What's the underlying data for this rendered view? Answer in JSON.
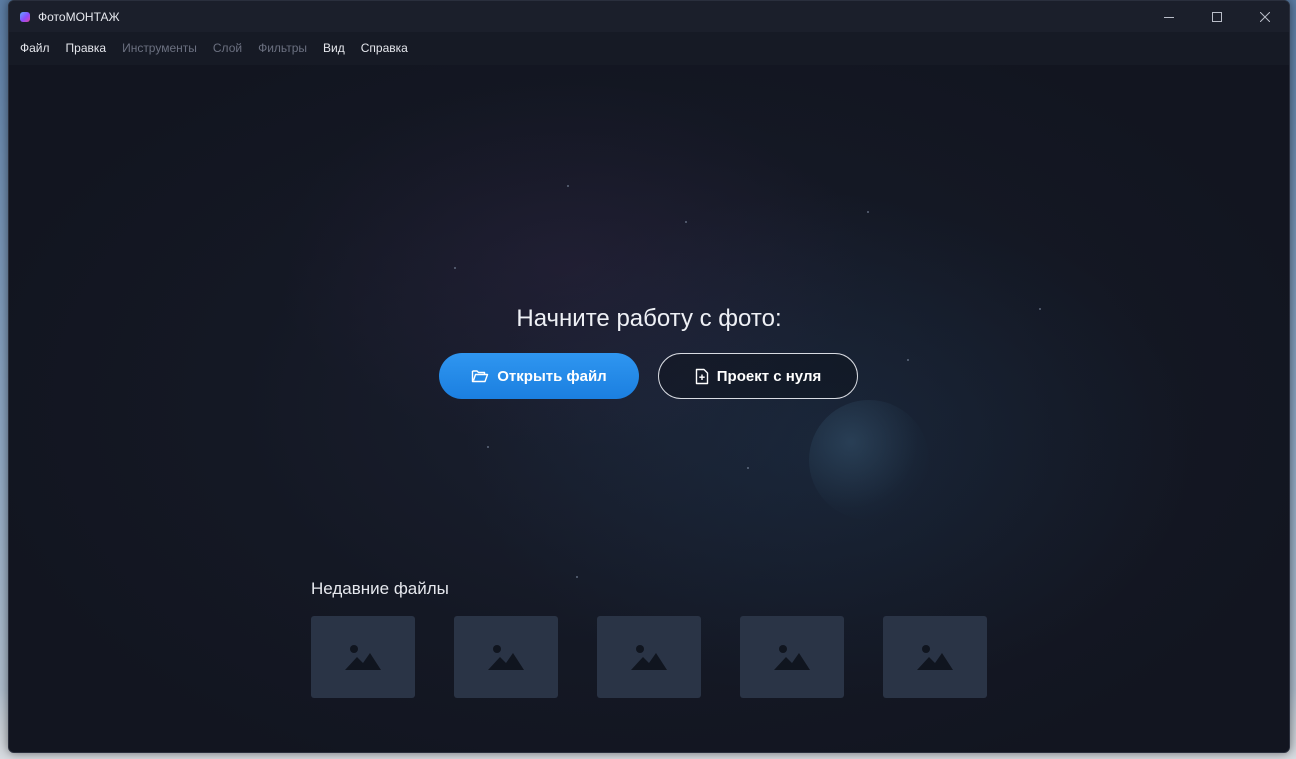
{
  "window": {
    "title": "ФотоМОНТАЖ"
  },
  "menu": [
    {
      "label": "Файл",
      "enabled": true
    },
    {
      "label": "Правка",
      "enabled": true
    },
    {
      "label": "Инструменты",
      "enabled": false
    },
    {
      "label": "Слой",
      "enabled": false
    },
    {
      "label": "Фильтры",
      "enabled": false
    },
    {
      "label": "Вид",
      "enabled": true
    },
    {
      "label": "Справка",
      "enabled": true
    }
  ],
  "start": {
    "heading": "Начните работу с фото:",
    "open_file_label": "Открыть файл",
    "new_project_label": "Проект с нуля"
  },
  "recent": {
    "title": "Недавние файлы",
    "placeholder_icon": "image-placeholder-icon",
    "count": 5
  },
  "colors": {
    "accent": "#1f86e6",
    "background": "#161a25",
    "thumb": "#2a3446"
  }
}
